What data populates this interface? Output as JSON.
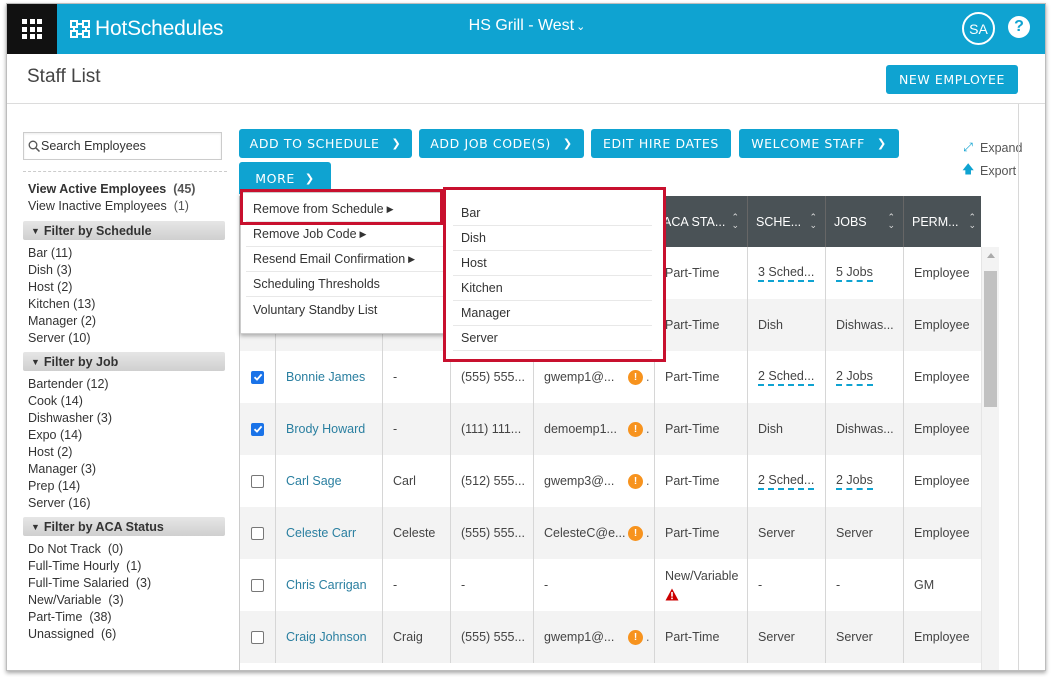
{
  "app": {
    "brand": "HotSchedules",
    "location": "HS Grill - West",
    "user_initials": "SA",
    "help_symbol": "?",
    "colors": {
      "brand": "#0fa3d1",
      "highlight": "#c8102e",
      "header_dark": "#4a5256",
      "link": "#2a7fa0",
      "warning_orange": "#f7931e",
      "alert_red": "#cc0000"
    }
  },
  "page": {
    "title": "Staff List",
    "new_employee_label": "NEW EMPLOYEE"
  },
  "sidebar": {
    "search_placeholder": "Search Employees",
    "views": [
      {
        "label": "View Active Employees",
        "count": "(45)"
      },
      {
        "label": "View Inactive Employees",
        "count": "(1)"
      }
    ],
    "filters": [
      {
        "title": "Filter by Schedule",
        "items": [
          "Bar (11)",
          "Dish (3)",
          "Host (2)",
          "Kitchen (13)",
          "Manager (2)",
          "Server (10)"
        ]
      },
      {
        "title": "Filter by Job",
        "items": [
          "Bartender (12)",
          "Cook (14)",
          "Dishwasher (3)",
          "Expo (14)",
          "Host (2)",
          "Manager (3)",
          "Prep (14)",
          "Server (16)"
        ]
      },
      {
        "title": "Filter by ACA Status",
        "items": [
          "Do Not Track  (0)",
          "Full-Time Hourly  (1)",
          "Full-Time Salaried  (3)",
          "New/Variable  (3)",
          "Part-Time  (38)",
          "Unassigned  (6)"
        ]
      }
    ]
  },
  "toolbar": {
    "add_to_schedule": "ADD TO SCHEDULE",
    "add_job_codes": "ADD JOB CODE(S)",
    "edit_hire_dates": "EDIT HIRE DATES",
    "welcome_staff": "WELCOME STAFF",
    "more": "MORE",
    "expand": "Expand",
    "export": "Export"
  },
  "more_menu": {
    "items": [
      "Remove from Schedule",
      "Remove Job Code",
      "Resend Email Confirmation",
      "Scheduling Thresholds",
      "Voluntary Standby List"
    ],
    "submenu_title": "Remove from Schedule",
    "submenu_items": [
      "Bar",
      "Dish",
      "Host",
      "Kitchen",
      "Manager",
      "Server"
    ]
  },
  "table": {
    "columns": [
      "",
      "",
      "",
      "",
      "",
      "ACA STA...",
      "SCHE...",
      "JOBS",
      "PERM..."
    ],
    "rows": [
      {
        "checked": false,
        "name": "",
        "nickname": "",
        "phone": "",
        "email": "",
        "email_warning": false,
        "aca": "Part-Time",
        "schedules": "3 Sched...",
        "schedules_link": true,
        "jobs": "5 Jobs",
        "jobs_link": true,
        "permission": "Employee"
      },
      {
        "checked": false,
        "name": "",
        "nickname": "",
        "phone": "",
        "email": "",
        "email_warning": false,
        "aca": "Part-Time",
        "schedules": "Dish",
        "schedules_link": false,
        "jobs": "Dishwas...",
        "jobs_link": false,
        "permission": "Employee"
      },
      {
        "checked": true,
        "name": "Bonnie James",
        "nickname": "-",
        "phone": "(555) 555...",
        "email": "gwemp1@...",
        "email_warning": true,
        "aca": "Part-Time",
        "schedules": "2 Sched...",
        "schedules_link": true,
        "jobs": "2 Jobs",
        "jobs_link": true,
        "permission": "Employee"
      },
      {
        "checked": true,
        "name": "Brody Howard",
        "nickname": "-",
        "phone": "(111) 111...",
        "email": "demoemp1...",
        "email_warning": true,
        "aca": "Part-Time",
        "schedules": "Dish",
        "schedules_link": false,
        "jobs": "Dishwas...",
        "jobs_link": false,
        "permission": "Employee"
      },
      {
        "checked": false,
        "name": "Carl Sage",
        "nickname": "Carl",
        "phone": "(512) 555...",
        "email": "gwemp3@...",
        "email_warning": true,
        "aca": "Part-Time",
        "schedules": "2 Sched...",
        "schedules_link": true,
        "jobs": "2 Jobs",
        "jobs_link": true,
        "permission": "Employee"
      },
      {
        "checked": false,
        "name": "Celeste Carr",
        "nickname": "Celeste",
        "phone": "(555) 555...",
        "email": "CelesteC@e...",
        "email_warning": true,
        "aca": "Part-Time",
        "schedules": "Server",
        "schedules_link": false,
        "jobs": "Server",
        "jobs_link": false,
        "permission": "Employee"
      },
      {
        "checked": false,
        "name": "Chris Carrigan",
        "nickname": "-",
        "phone": "-",
        "email": "-",
        "email_warning": false,
        "aca": "New/Variable",
        "aca_alert": true,
        "schedules": "-",
        "schedules_link": false,
        "jobs": "-",
        "jobs_link": false,
        "permission": "GM"
      },
      {
        "checked": false,
        "name": "Craig Johnson",
        "nickname": "Craig",
        "phone": "(555) 555...",
        "email": "gwemp1@...",
        "email_warning": true,
        "aca": "Part-Time",
        "schedules": "Server",
        "schedules_link": false,
        "jobs": "Server",
        "jobs_link": false,
        "permission": "Employee"
      }
    ]
  }
}
